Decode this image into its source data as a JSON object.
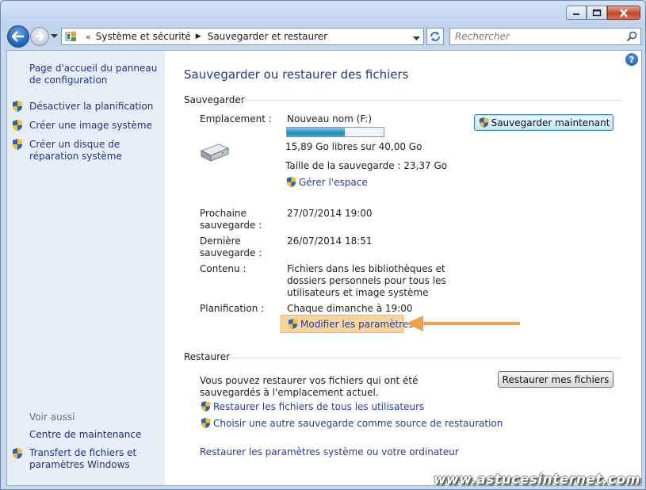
{
  "titlebar": {
    "minimize": "minimize",
    "maximize": "maximize",
    "close": "close"
  },
  "nav": {
    "back": "back",
    "forward": "forward",
    "breadcrumb": {
      "prefix": "«",
      "items": [
        "Système et sécurité",
        "Sauvegarder et restaurer"
      ]
    },
    "search_placeholder": "Rechercher"
  },
  "sidebar": {
    "home_link": "Page d'accueil du panneau de configuration",
    "tasks": [
      "Désactiver la planification",
      "Créer une image système",
      "Créer un disque de réparation système"
    ],
    "see_also_title": "Voir aussi",
    "see_also": [
      "Centre de maintenance",
      "Transfert de fichiers et paramètres Windows"
    ]
  },
  "main": {
    "title": "Sauvegarder ou restaurer des fichiers",
    "backup": {
      "header": "Sauvegarder",
      "location_label": "Emplacement :",
      "drive_name": "Nouveau nom (F:)",
      "drive_usage_fraction": 0.6,
      "free_space": "15,89 Go libres sur 40,00 Go",
      "backup_size": "Taille de la sauvegarde : 23,37 Go",
      "manage_space_link": "Gérer l'espace",
      "backup_now_button": "Sauvegarder maintenant",
      "next_backup_label": "Prochaine sauvegarde :",
      "next_backup_value": "27/07/2014 19:00",
      "last_backup_label": "Dernière sauvegarde :",
      "last_backup_value": "26/07/2014 18:51",
      "contents_label": "Contenu :",
      "contents_value": "Fichiers dans les bibliothèques et dossiers personnels pour tous les utilisateurs et image système",
      "schedule_label": "Planification :",
      "schedule_value": "Chaque dimanche à 19:00",
      "change_settings_link": "Modifier les paramètres"
    },
    "restore": {
      "header": "Restaurer",
      "description": "Vous pouvez restaurer vos fichiers qui ont été sauvegardés à l'emplacement actuel.",
      "restore_my_files_button": "Restaurer mes fichiers",
      "restore_all_users_link": "Restaurer les fichiers de tous les utilisateurs",
      "choose_other_backup_link": "Choisir une autre sauvegarde comme source de restauration",
      "recover_system_link": "Restaurer les paramètres système ou votre ordinateur"
    }
  },
  "watermark": "www.astucesinternet.com",
  "colors": {
    "link": "#1f3fa0",
    "highlight": "#fbd49b",
    "arrow": "#f0a048"
  }
}
